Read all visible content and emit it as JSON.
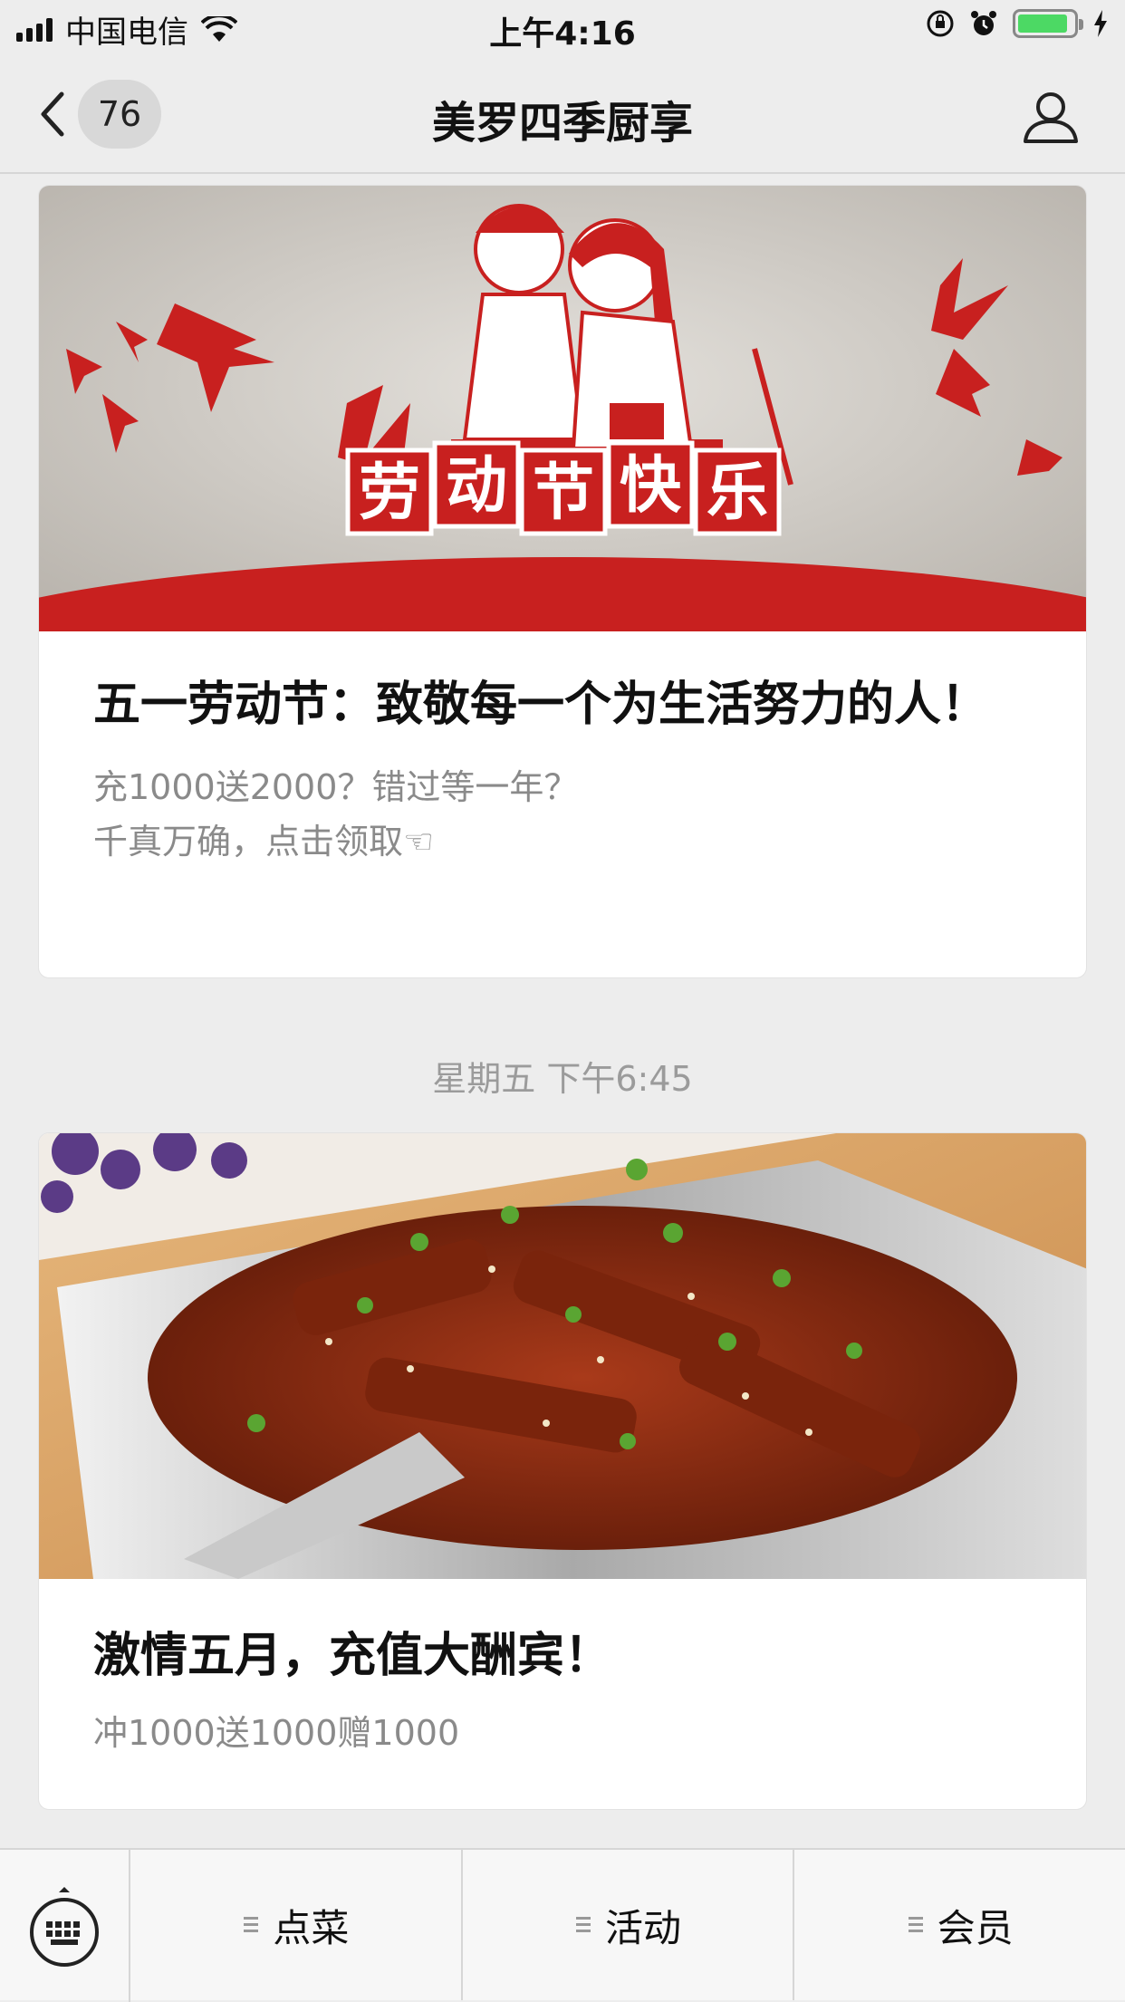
{
  "status_bar": {
    "carrier": "中国电信",
    "time": "上午4:16",
    "battery_level": 0.9
  },
  "nav": {
    "unread_count": "76",
    "title": "美罗四季厨享"
  },
  "articles": [
    {
      "banner_text": "劳动节快乐",
      "title": "五一劳动节：致敬每一个为生活努力的人！",
      "desc_lines": [
        "充1000送2000？错过等一年？",
        "千真万确，点击领取☜"
      ]
    },
    {
      "title": "激情五月，充值大酬宾！",
      "desc_lines": [
        "冲1000送1000赠1000"
      ]
    }
  ],
  "timestamp": "星期五 下午6:45",
  "bottom_menu": {
    "items": [
      {
        "label": "点菜",
        "icon": "menu-lines-icon"
      },
      {
        "label": "活动",
        "icon": "menu-lines-icon"
      },
      {
        "label": "会员",
        "icon": "menu-lines-icon"
      }
    ]
  },
  "colors": {
    "banner_red": "#c8201f",
    "background": "#ededed",
    "battery_green": "#4cd964"
  }
}
